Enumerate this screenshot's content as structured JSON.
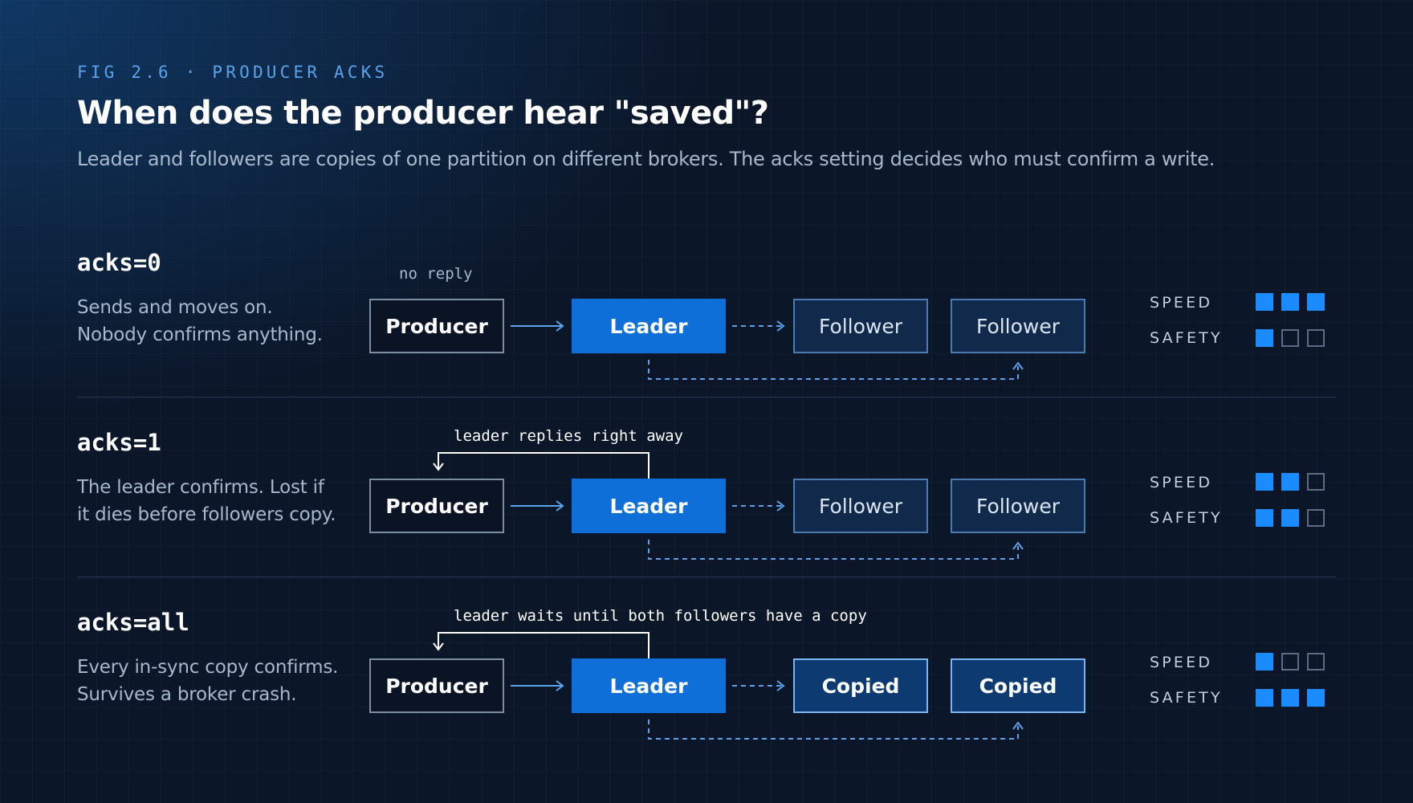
{
  "header": {
    "eyebrow": "FIG 2.6 · PRODUCER ACKS",
    "title": "When does the producer hear \"saved\"?",
    "subtitle": "Leader and followers are copies of one partition on different brokers. The acks setting decides who must confirm a write."
  },
  "meter_labels": {
    "speed": "SPEED",
    "safety": "SAFETY"
  },
  "rows": [
    {
      "label": "acks=0",
      "description": [
        "Sends and moves on.",
        "Nobody confirms anything."
      ],
      "note": "no reply",
      "nodes": {
        "producer": "Producer",
        "leader": "Leader",
        "follower1": "Follower",
        "follower2": "Follower"
      },
      "follower_style": "follower",
      "speed": 3,
      "safety": 1
    },
    {
      "label": "acks=1",
      "description": [
        "The leader confirms. Lost if",
        "it dies before followers copy."
      ],
      "note": "leader replies right away",
      "nodes": {
        "producer": "Producer",
        "leader": "Leader",
        "follower1": "Follower",
        "follower2": "Follower"
      },
      "follower_style": "follower",
      "speed": 2,
      "safety": 2
    },
    {
      "label": "acks=all",
      "description": [
        "Every in-sync copy confirms.",
        "Survives a broker crash."
      ],
      "note": "leader waits until both followers have a copy",
      "nodes": {
        "producer": "Producer",
        "leader": "Leader",
        "follower1": "Copied",
        "follower2": "Copied"
      },
      "follower_style": "copied",
      "speed": 1,
      "safety": 3
    }
  ],
  "colors": {
    "accent": "#0f6fd8",
    "meter_on": "#1a8cff",
    "eyebrow": "#5aa2ea",
    "background": "#0b1628"
  }
}
